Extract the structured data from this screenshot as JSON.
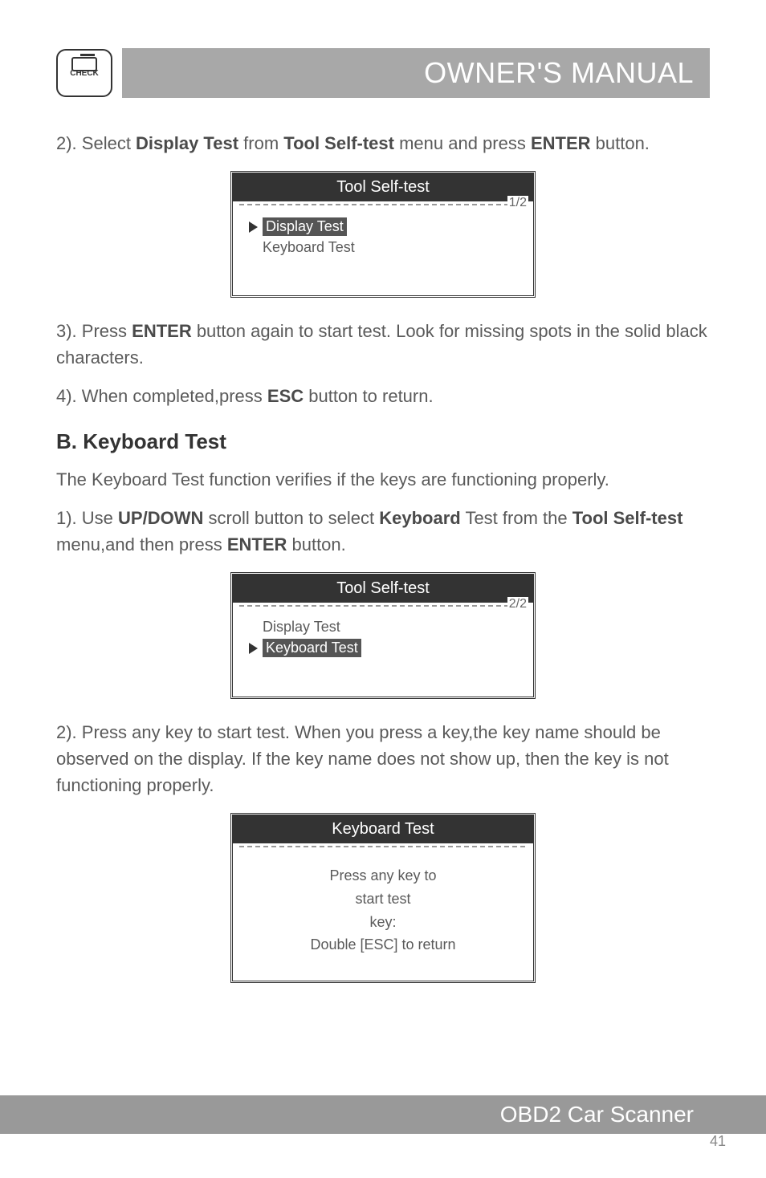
{
  "header": {
    "icon_label": "CHECK",
    "title": "OWNER'S MANUAL"
  },
  "section2": {
    "step2_prefix": "2). Select ",
    "step2_bold1": "Display Test",
    "step2_mid": " from ",
    "step2_bold2": "Tool Self-test",
    "step2_mid2": " menu and press ",
    "step2_bold3": "ENTER",
    "step2_suffix": " button."
  },
  "screen1": {
    "title": "Tool Self-test",
    "page": "1/2",
    "item1": "Display Test",
    "item2": "Keyboard Test"
  },
  "section3": {
    "step3_prefix": "3). Press ",
    "step3_bold": "ENTER",
    "step3_suffix": " button again to start test. Look for missing spots in the solid black characters.",
    "step4_prefix": "4). When completed,press ",
    "step4_bold": "ESC",
    "step4_suffix": " button to return."
  },
  "sectionB": {
    "heading": "B.  Keyboard Test",
    "intro": "The Keyboard Test function verifies if the keys are functioning properly.",
    "step1_prefix": "1). Use ",
    "step1_bold1": "UP/DOWN",
    "step1_mid1": " scroll button to select ",
    "step1_bold2": "Keyboard",
    "step1_mid2": " Test from the ",
    "step1_bold3": "Tool Self-test",
    "step1_mid3": " menu,and then press ",
    "step1_bold4": "ENTER",
    "step1_suffix": " button."
  },
  "screen2": {
    "title": "Tool Self-test",
    "page": "2/2",
    "item1": "Display Test",
    "item2": "Keyboard Test"
  },
  "sectionC": {
    "step2": "2). Press any key to start test. When you press a key,the key name should be observed on the display. If the key name does  not show up, then the key is not functioning properly."
  },
  "screen3": {
    "title": "Keyboard Test",
    "line1": "Press any key to",
    "line2": "start test",
    "line3": "key:",
    "line4": "Double [ESC] to return"
  },
  "footer": {
    "text": "OBD2 Car Scanner",
    "page_num": "41"
  }
}
